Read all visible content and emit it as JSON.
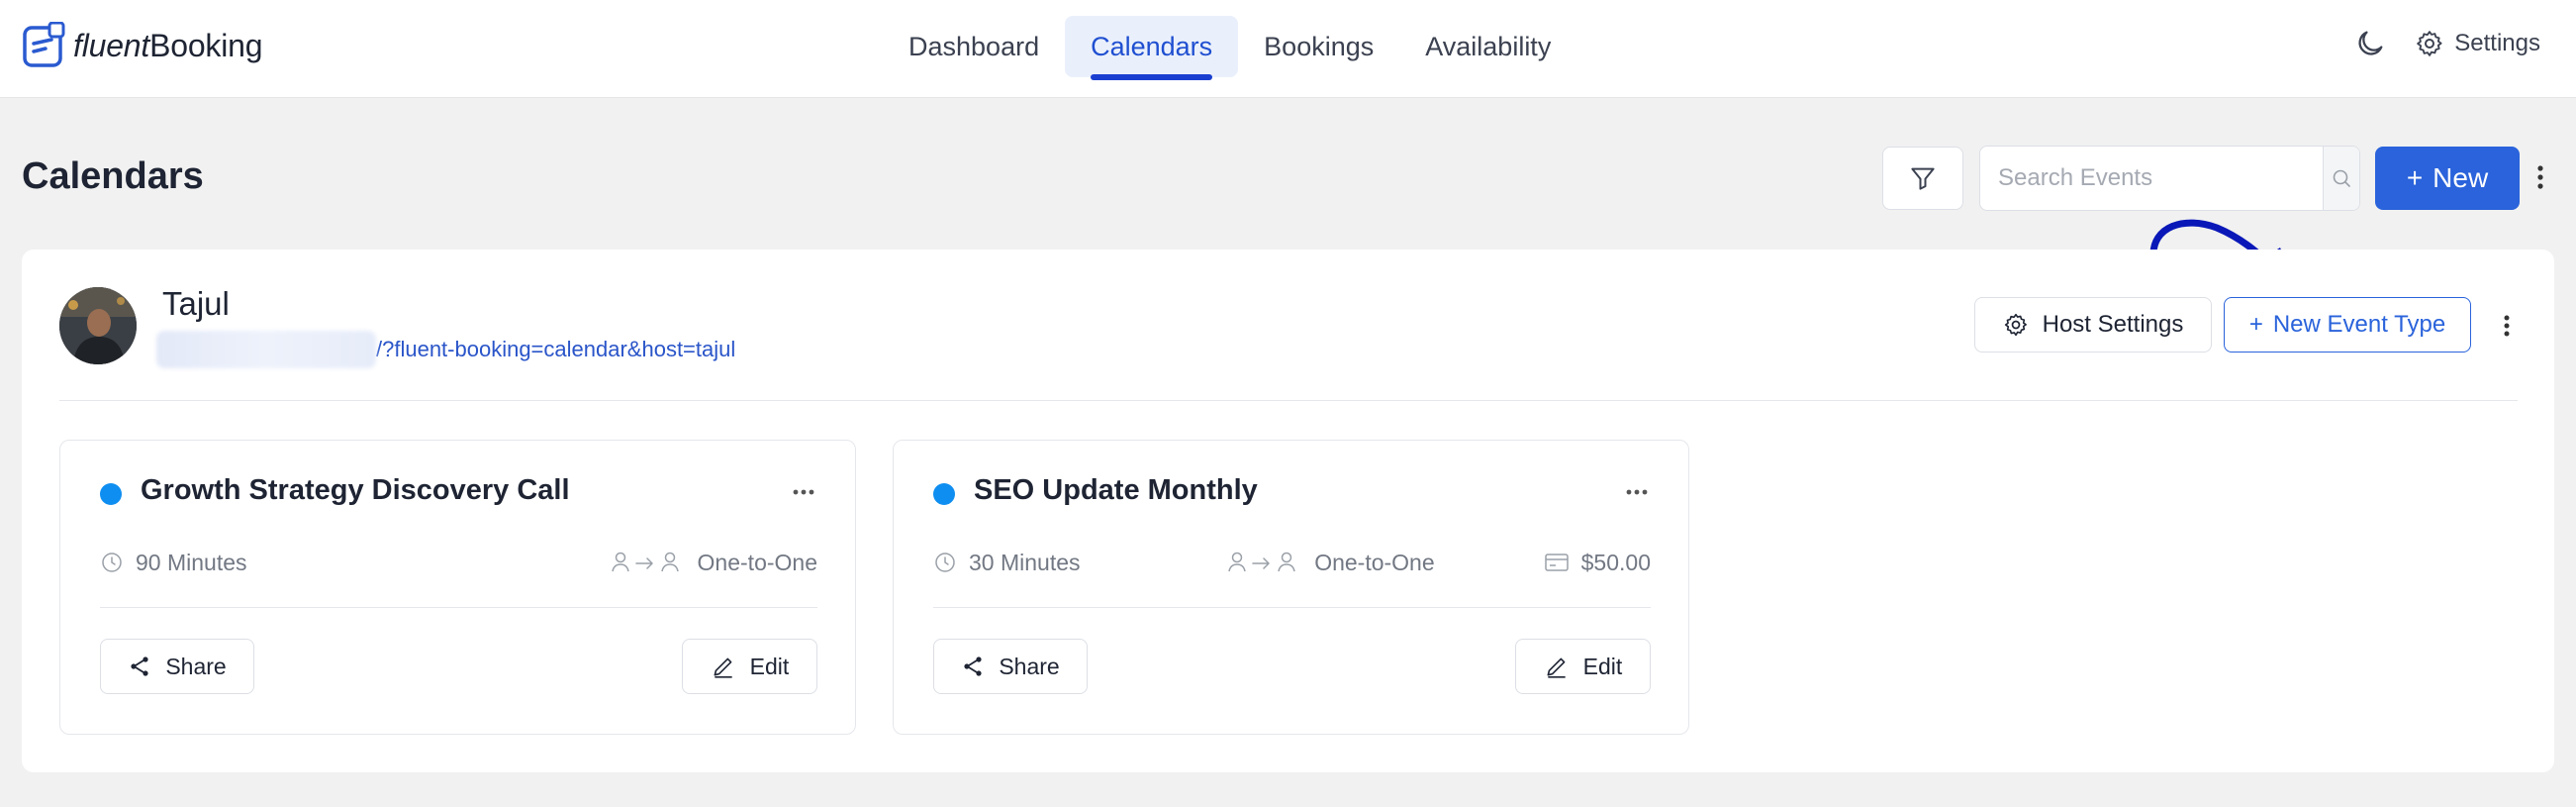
{
  "app": {
    "logo_italic": "fluent",
    "logo_bold": "Booking"
  },
  "nav": [
    {
      "label": "Dashboard",
      "active": false
    },
    {
      "label": "Calendars",
      "active": true
    },
    {
      "label": "Bookings",
      "active": false
    },
    {
      "label": "Availability",
      "active": false
    }
  ],
  "top_right": {
    "theme_icon": "moon-icon",
    "settings_label": "Settings"
  },
  "page": {
    "title": "Calendars"
  },
  "toolbar": {
    "search_placeholder": "Search Events",
    "new_label": "New"
  },
  "host": {
    "name": "Tajul",
    "url_visible": "/?fluent-booking=calendar&host=tajul",
    "host_settings_label": "Host Settings",
    "new_event_type_label": "New Event Type"
  },
  "events": [
    {
      "title": "Growth Strategy Discovery Call",
      "duration": "90 Minutes",
      "type": "One-to-One",
      "price": "",
      "share_label": "Share",
      "edit_label": "Edit"
    },
    {
      "title": "SEO Update Monthly",
      "duration": "30 Minutes",
      "type": "One-to-One",
      "price": "$50.00",
      "share_label": "Share",
      "edit_label": "Edit"
    }
  ],
  "colors": {
    "accent": "#2a63db",
    "event_dot": "#0e8ef0",
    "annotation_arrow": "#0a18b8"
  }
}
